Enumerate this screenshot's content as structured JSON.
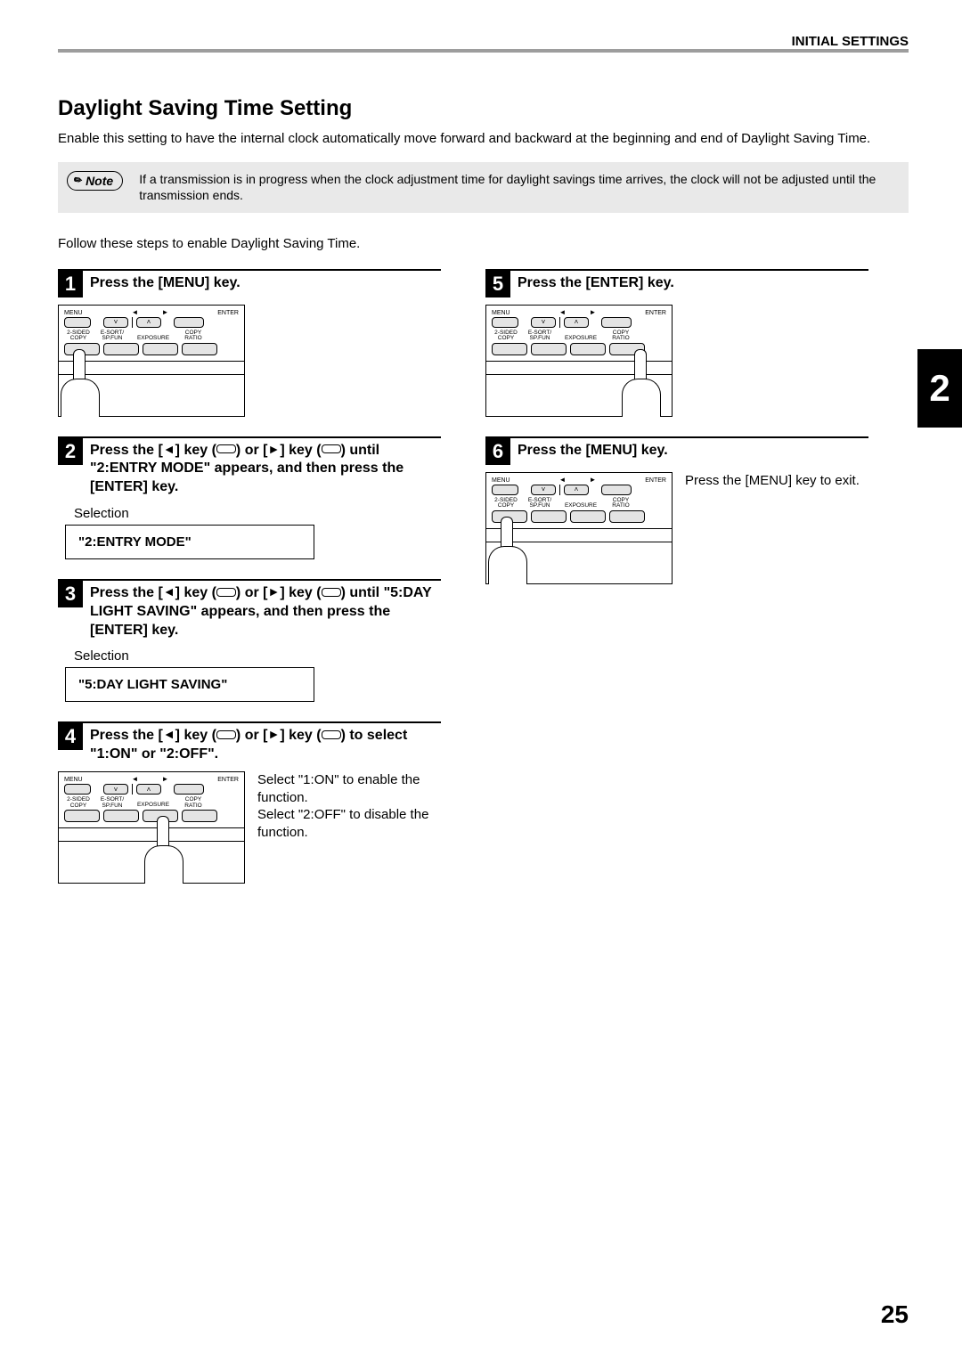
{
  "header": {
    "section_label": "INITIAL SETTINGS"
  },
  "title": "Daylight Saving Time Setting",
  "intro": "Enable this setting to have the internal clock automatically move forward and backward at the beginning and end of Daylight Saving Time.",
  "note": {
    "label": "Note",
    "text": "If a transmission is in progress when the clock adjustment time for daylight savings time arrives, the clock will not be adjusted until the transmission ends."
  },
  "follow": "Follow these steps to enable Daylight Saving Time.",
  "panel_labels": {
    "menu": "MENU",
    "enter": "ENTER",
    "twoSided": "2-SIDED",
    "copy": "COPY",
    "esort": "E-SORT/",
    "spfun": "SP.FUN",
    "exposure": "EXPOSURE",
    "ratio": "RATIO",
    "left_tri": "◄",
    "right_tri": "►",
    "down": "˅",
    "up": "˄"
  },
  "steps": {
    "s1": {
      "num": "1",
      "title": "Press the [MENU] key."
    },
    "s2": {
      "num": "2",
      "title_a": "Press the [",
      "title_b": "] key (",
      "title_c": ") or [",
      "title_d": "] key (",
      "title_e": ") until \"2:ENTRY MODE\" appears, and then press the [ENTER] key.",
      "selection_label": "Selection",
      "selection_value": "\"2:ENTRY MODE\""
    },
    "s3": {
      "num": "3",
      "title_a": "Press the [",
      "title_b": "] key (",
      "title_c": ") or [",
      "title_d": "] key (",
      "title_e": ") until \"5:DAY LIGHT SAVING\" appears, and then press the [ENTER] key.",
      "selection_label": "Selection",
      "selection_value": "\"5:DAY LIGHT SAVING\""
    },
    "s4": {
      "num": "4",
      "title_a": "Press the [",
      "title_b": "] key (",
      "title_c": ") or [",
      "title_d": "] key (",
      "title_e": ") to select \"1:ON\" or \"2:OFF\".",
      "body1": "Select \"1:ON\" to enable the function.",
      "body2": "Select \"2:OFF\" to disable the function."
    },
    "s5": {
      "num": "5",
      "title": "Press the [ENTER] key."
    },
    "s6": {
      "num": "6",
      "title": "Press the [MENU] key.",
      "body": "Press the [MENU] key to exit."
    }
  },
  "chapter": "2",
  "page_number": "25"
}
